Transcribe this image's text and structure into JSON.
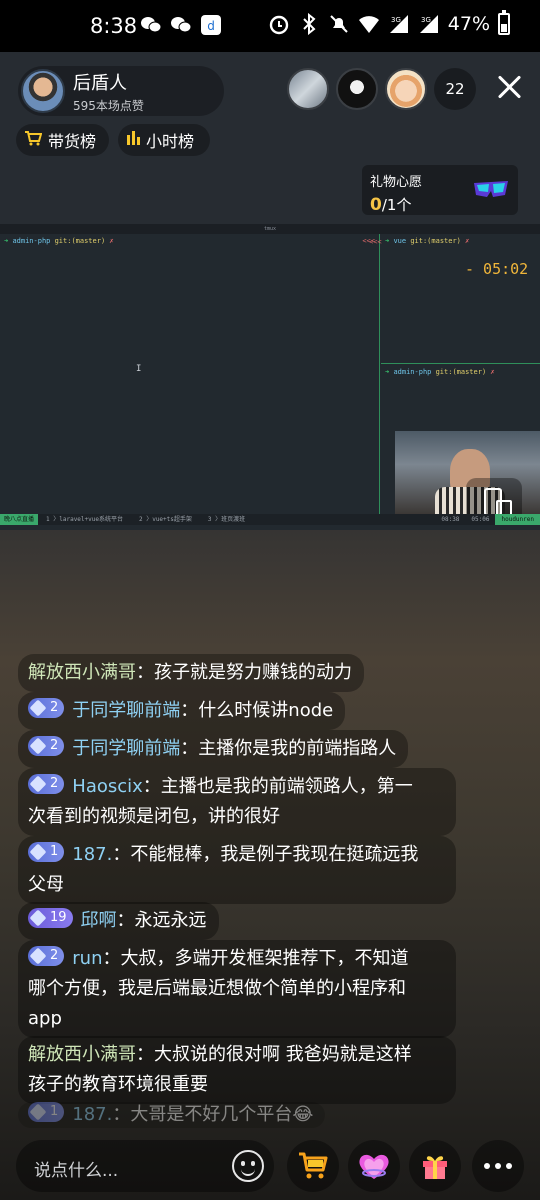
{
  "status_bar": {
    "time": "8:38",
    "signal1": "3G",
    "signal2": "3G",
    "battery": "47%",
    "battery_level": 0.47
  },
  "anchor": {
    "name": "后盾人",
    "likes": "595本场点赞"
  },
  "viewers": {
    "count": "22"
  },
  "chips": {
    "cart": "带货榜",
    "hour": "小时榜"
  },
  "gift_wish": {
    "title": "礼物心愿",
    "current": "0",
    "total": "/1个"
  },
  "screen": {
    "tmux_title": "tmux",
    "left_prompt_arrow": "➜",
    "left_dir": "admin-php",
    "left_git": "git:(master)",
    "left_x": "✗",
    "left_tail": "<<<",
    "right_top_dir": "vue",
    "right_top_git": "git:(master)",
    "right_top_x": "✗",
    "right_top_tail": "<<<",
    "timer": "- 05:02",
    "right_bot_dir": "admin-php",
    "right_bot_git": "git:(master)",
    "right_bot_x": "✗",
    "cursor": "I",
    "status_session": "晚八点直播",
    "status_win1": "1 〉laravel+vue系统平台",
    "status_win2": "2 〉vue+ts超手架",
    "status_win3": "3 〉班页渡班",
    "status_time1": "08:38",
    "status_time2": "05:06",
    "status_host": "houdunren"
  },
  "chat": [
    {
      "level": "",
      "name": "解放西小满哥",
      "text": "孩子就是努力赚钱的动力",
      "system": true
    },
    {
      "level": "2",
      "name": "于同学聊前端",
      "text": "什么时候讲node"
    },
    {
      "level": "2",
      "name": "于同学聊前端",
      "text": "主播你是我的前端指路人"
    },
    {
      "level": "2",
      "name": "Haoscix",
      "text": "主播也是我的前端领路人，第一",
      "text2": "次看到的视频是闭包，讲的很好"
    },
    {
      "level": "1",
      "name": "187.",
      "text": "不能棍棒，我是例子我现在挺疏远我",
      "text2": "父母"
    },
    {
      "level": "19",
      "name": "邱啊",
      "text": "永远永远"
    },
    {
      "level": "2",
      "name": "run",
      "text": "大叔，多端开发框架推荐下，不知道",
      "text2": "哪个方便，我是后端最近想做个简单的小程序和",
      "text3": "app"
    },
    {
      "level": "",
      "name": "解放西小满哥",
      "text": "大叔说的很对啊 我爸妈就是这样",
      "text2": "孩子的教育环境很重要",
      "system": true
    },
    {
      "level": "1",
      "name": "187.",
      "text": "大哥是不好几个平台😂"
    }
  ],
  "bottom": {
    "comment_placeholder": "说点什么..."
  },
  "colors": {
    "accent_yellow": "#f6c546",
    "name_blue": "#8fd1f3",
    "level_blue": "#5a6fd8",
    "tmux_green": "#3aa86b"
  },
  "icons": {
    "cart": "cart-icon",
    "rank": "bar-chart-icon",
    "glasses": "glasses-icon",
    "close": "close-icon",
    "emoji": "smile-icon",
    "shop": "shopping-cart-icon",
    "heart": "heart-icon",
    "gift": "gift-icon",
    "more": "more-icon",
    "camera_switch": "screen-switch-icon"
  }
}
